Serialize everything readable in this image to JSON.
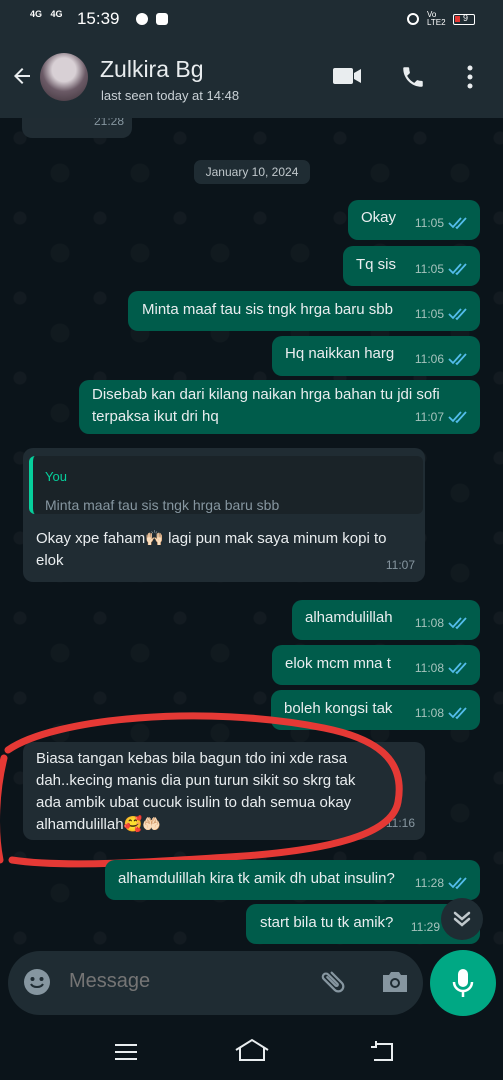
{
  "status_bar": {
    "signal_1": "4G",
    "signal_2": "4G",
    "time": "15:39",
    "network": "Vo LTE2",
    "battery": "9"
  },
  "header": {
    "contact_name": "Zulkira Bg",
    "last_seen": "last seen today at 14:48"
  },
  "chat": {
    "top_partial_time": "21:28",
    "date_chip": "January 10, 2024",
    "messages": [
      {
        "text": "Okay",
        "time": "11:05"
      },
      {
        "text": "Tq sis",
        "time": "11:05"
      },
      {
        "text": "Minta maaf tau sis tngk hrga baru sbb",
        "time": "11:05"
      },
      {
        "text": "Hq naikkan harg",
        "time": "11:06"
      },
      {
        "text": "Disebab kan dari kilang naikan hrga bahan tu jdi sofi terpaksa ikut dri hq",
        "time": "11:07"
      },
      {
        "quote_author": "You",
        "quote_text": "Minta maaf tau sis tngk hrga baru sbb",
        "text": "Okay xpe faham🙌🏻 lagi pun mak saya minum kopi to elok",
        "time": "11:07"
      },
      {
        "text": "alhamdulillah",
        "time": "11:08"
      },
      {
        "text": "elok mcm mna t",
        "time": "11:08"
      },
      {
        "text": "boleh kongsi tak",
        "time": "11:08"
      },
      {
        "text": "Biasa tangan kebas bila bagun tdo ini xde rasa dah..kecing manis dia pun turun sikit so skrg tak ada ambik ubat cucuk isulin to dah semua okay alhamdulillah🥰🤲🏻",
        "time": "11:16"
      },
      {
        "text": "alhamdulillah kira tk amik dh ubat insulin?",
        "time": "11:28"
      },
      {
        "text": "start bila tu tk amik?",
        "time": "11:29"
      }
    ]
  },
  "input": {
    "placeholder": "Message"
  },
  "colors": {
    "outgoing": "#005c4b",
    "incoming": "#202c33",
    "accent": "#00a884",
    "read_tick": "#53bdeb",
    "highlight": "#e53935"
  }
}
